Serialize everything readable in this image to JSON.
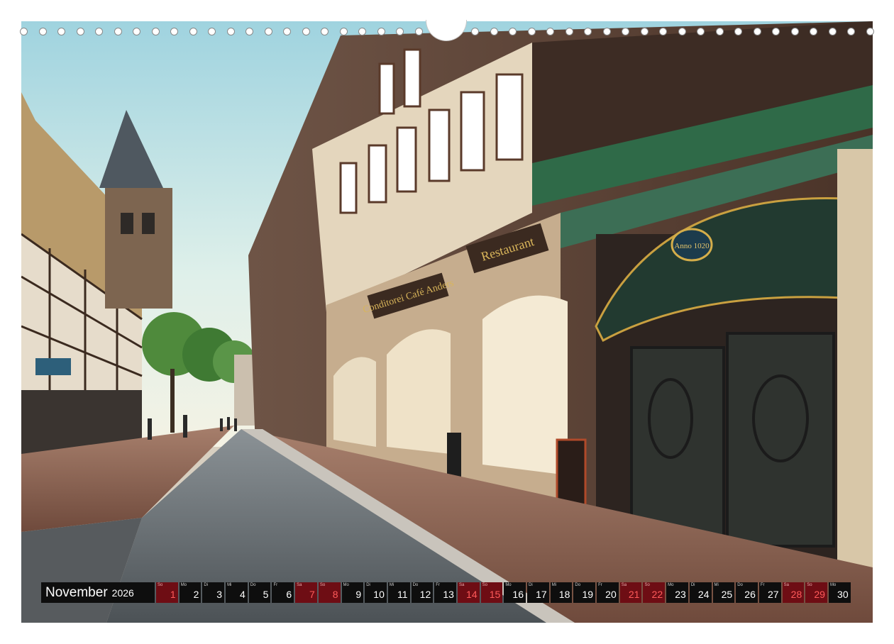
{
  "calendar": {
    "month": "November",
    "year": "2026",
    "days": [
      {
        "weekday": "So",
        "day": "1",
        "weekend": true
      },
      {
        "weekday": "Mo",
        "day": "2",
        "weekend": false
      },
      {
        "weekday": "Di",
        "day": "3",
        "weekend": false
      },
      {
        "weekday": "Mi",
        "day": "4",
        "weekend": false
      },
      {
        "weekday": "Do",
        "day": "5",
        "weekend": false
      },
      {
        "weekday": "Fr",
        "day": "6",
        "weekend": false
      },
      {
        "weekday": "Sa",
        "day": "7",
        "weekend": true
      },
      {
        "weekday": "So",
        "day": "8",
        "weekend": true
      },
      {
        "weekday": "Mo",
        "day": "9",
        "weekend": false
      },
      {
        "weekday": "Di",
        "day": "10",
        "weekend": false
      },
      {
        "weekday": "Mi",
        "day": "11",
        "weekend": false
      },
      {
        "weekday": "Do",
        "day": "12",
        "weekend": false
      },
      {
        "weekday": "Fr",
        "day": "13",
        "weekend": false
      },
      {
        "weekday": "Sa",
        "day": "14",
        "weekend": true
      },
      {
        "weekday": "So",
        "day": "15",
        "weekend": true
      },
      {
        "weekday": "Mo",
        "day": "16",
        "weekend": false
      },
      {
        "weekday": "Di",
        "day": "17",
        "weekend": false
      },
      {
        "weekday": "Mi",
        "day": "18",
        "weekend": false
      },
      {
        "weekday": "Do",
        "day": "19",
        "weekend": false
      },
      {
        "weekday": "Fr",
        "day": "20",
        "weekend": false
      },
      {
        "weekday": "Sa",
        "day": "21",
        "weekend": true
      },
      {
        "weekday": "So",
        "day": "22",
        "weekend": true
      },
      {
        "weekday": "Mo",
        "day": "23",
        "weekend": false
      },
      {
        "weekday": "Di",
        "day": "24",
        "weekend": false
      },
      {
        "weekday": "Mi",
        "day": "25",
        "weekend": false
      },
      {
        "weekday": "Do",
        "day": "26",
        "weekend": false
      },
      {
        "weekday": "Fr",
        "day": "27",
        "weekend": false
      },
      {
        "weekday": "Sa",
        "day": "28",
        "weekend": true
      },
      {
        "weekday": "So",
        "day": "29",
        "weekend": true
      },
      {
        "weekday": "Mo",
        "day": "30",
        "weekend": false
      }
    ]
  },
  "photo": {
    "signs": {
      "restaurant": "Restaurant",
      "cafe": "Conditorei Café Anders",
      "year_plaque": "Anno 1020"
    }
  },
  "colors": {
    "weekday_bg": "#0e0e0e",
    "weekend_bg": "#6e0d14",
    "weekend_text": "#ff5a5a"
  },
  "icons": {
    "binding": "spiral-binding-icon"
  }
}
